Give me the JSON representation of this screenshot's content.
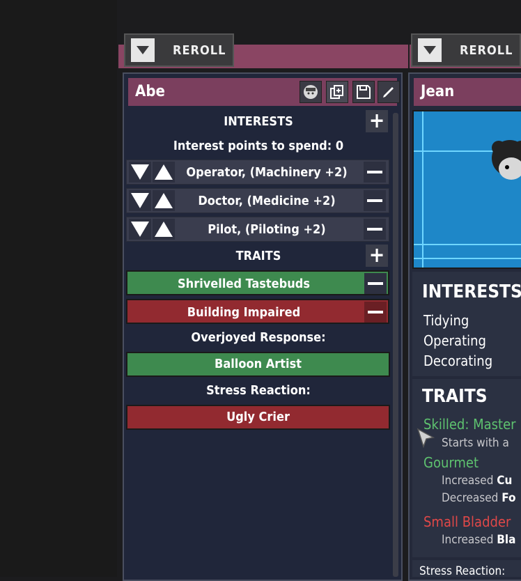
{
  "left_panel": {
    "reroll_label": "REROLL",
    "name": "Abe",
    "interests_title": "INTERESTS",
    "interest_points": "Interest points to spend: 0",
    "interests": [
      {
        "label": "Operator, (Machinery +2)"
      },
      {
        "label": "Doctor, (Medicine +2)"
      },
      {
        "label": "Pilot, (Piloting +2)"
      }
    ],
    "traits_title": "TRAITS",
    "traits": [
      {
        "label": "Shrivelled Tastebuds",
        "kind": "positive"
      },
      {
        "label": "Building Impaired",
        "kind": "negative"
      }
    ],
    "overjoyed_label": "Overjoyed Response:",
    "overjoyed_value": "Balloon Artist",
    "stress_label": "Stress Reaction:",
    "stress_value": "Ugly Crier"
  },
  "right_panel": {
    "reroll_label": "REROLL",
    "name": "Jean",
    "interests_title": "INTERESTS",
    "interests": [
      "Tidying",
      "Operating",
      "Decorating"
    ],
    "traits_title": "TRAITS",
    "trait1_name": "Skilled: Master",
    "trait1_desc": "Starts with a",
    "trait2_name": "Gourmet",
    "trait2_desc1_prefix": "Increased ",
    "trait2_desc1_bold": "Cu",
    "trait2_desc2_prefix": "Decreased ",
    "trait2_desc2_bold": "Fo",
    "trait3_name": "Small Bladder",
    "trait3_desc_prefix": "Increased ",
    "trait3_desc_bold": "Bla",
    "stress_label": "Stress Reaction:"
  },
  "colors": {
    "panel_bg": "#20263a",
    "header": "#7b3f5e",
    "positive": "#3e8a4f",
    "negative": "#922a30",
    "positive_text": "#5ec26f",
    "negative_text": "#e04848"
  },
  "icons": [
    "chevron-down-icon",
    "face-icon",
    "copy-icon",
    "save-icon",
    "pencil-icon",
    "plus-icon",
    "minus-icon",
    "arrow-up-icon",
    "arrow-down-icon",
    "mouse-cursor-icon"
  ]
}
